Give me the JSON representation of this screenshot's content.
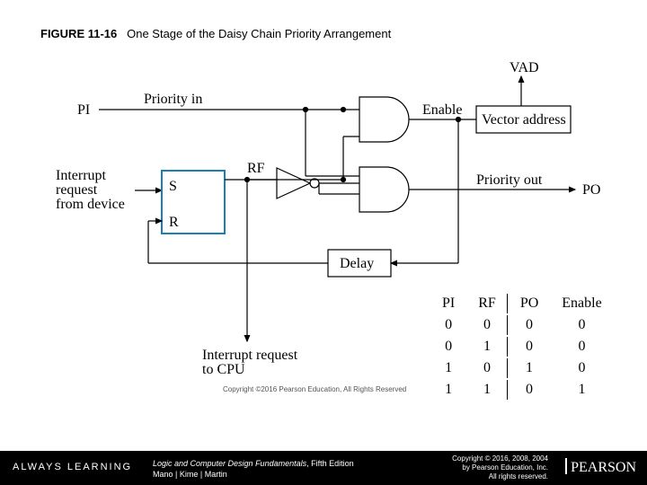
{
  "figure": {
    "number": "FIGURE 11-16",
    "title": "One Stage of the Daisy Chain Priority Arrangement"
  },
  "labels": {
    "pi": "PI",
    "priority_in": "Priority in",
    "enable": "Enable",
    "vector_address": "Vector address",
    "vad": "VAD",
    "interrupt_from_device": "Interrupt\nrequest\nfrom device",
    "s": "S",
    "r": "R",
    "rf": "RF",
    "priority_out": "Priority out",
    "po": "PO",
    "delay": "Delay",
    "interrupt_to_cpu": "Interrupt request\nto CPU"
  },
  "truth_table": {
    "headers": [
      "PI",
      "RF",
      "PO",
      "Enable"
    ],
    "rows": [
      [
        "0",
        "0",
        "0",
        "0"
      ],
      [
        "0",
        "1",
        "0",
        "0"
      ],
      [
        "1",
        "0",
        "1",
        "0"
      ],
      [
        "1",
        "1",
        "0",
        "1"
      ]
    ]
  },
  "image_copyright": "Copyright ©2016 Pearson Education, All Rights Reserved",
  "footer": {
    "always_learning": "ALWAYS LEARNING",
    "book_title": "Logic and Computer Design Fundamentals",
    "edition": ", Fifth Edition",
    "authors": "Mano | Kime | Martin",
    "copyright": "Copyright © 2016, 2008, 2004\nby Pearson Education, Inc.\nAll rights reserved.",
    "brand": "PEARSON"
  }
}
